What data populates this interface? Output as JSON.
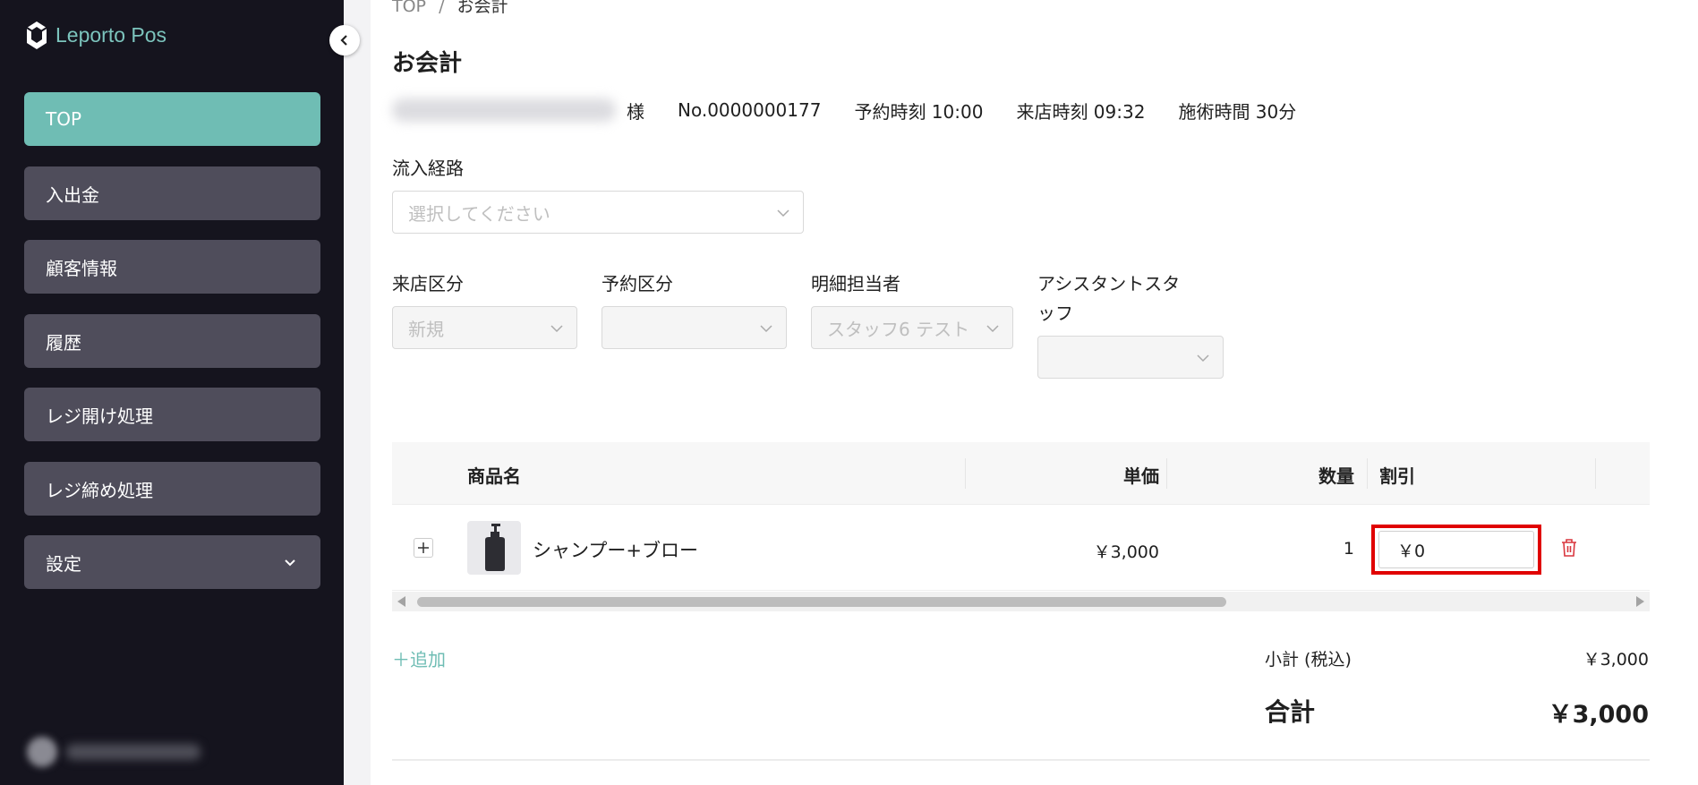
{
  "app": {
    "name": "Leporto Pos"
  },
  "sidebar": {
    "items": [
      {
        "label": "TOP",
        "active": true
      },
      {
        "label": "入出金"
      },
      {
        "label": "顧客情報"
      },
      {
        "label": "履歴"
      },
      {
        "label": "レジ開け処理"
      },
      {
        "label": "レジ締め処理"
      },
      {
        "label": "設定",
        "has_submenu": true
      }
    ]
  },
  "breadcrumb": {
    "home": "TOP",
    "separator": "/",
    "current": "お会計"
  },
  "page": {
    "title": "お会計"
  },
  "customer": {
    "honorific": "様",
    "number": "No.0000000177",
    "reservation_time": "予約時刻 10:00",
    "visit_time": "来店時刻 09:32",
    "treatment_time": "施術時間 30分"
  },
  "form": {
    "inflow_route": {
      "label": "流入経路",
      "placeholder": "選択してください"
    },
    "visit_type": {
      "label": "来店区分",
      "value": "新規"
    },
    "reservation_type": {
      "label": "予約区分",
      "value": ""
    },
    "staff": {
      "label": "明細担当者",
      "value": "スタッフ6 テスト"
    },
    "assistant": {
      "label_line1": "アシスタントスタ",
      "label_line2": "ッフ",
      "value": ""
    }
  },
  "table": {
    "headers": {
      "product": "商品名",
      "unit_price": "単価",
      "quantity": "数量",
      "discount": "割引"
    },
    "rows": [
      {
        "product": "シャンプー+ブロー",
        "unit_price": "￥3,000",
        "quantity": "1",
        "discount": "￥0"
      }
    ]
  },
  "actions": {
    "add": "＋追加"
  },
  "summary": {
    "subtotal_label": "小計 (税込)",
    "subtotal_value": "￥3,000",
    "total_label": "合計",
    "total_value": "￥3,000"
  },
  "colors": {
    "accent": "#6fbdb4",
    "sidebar_bg": "#15141e",
    "highlight": "#e00000"
  }
}
